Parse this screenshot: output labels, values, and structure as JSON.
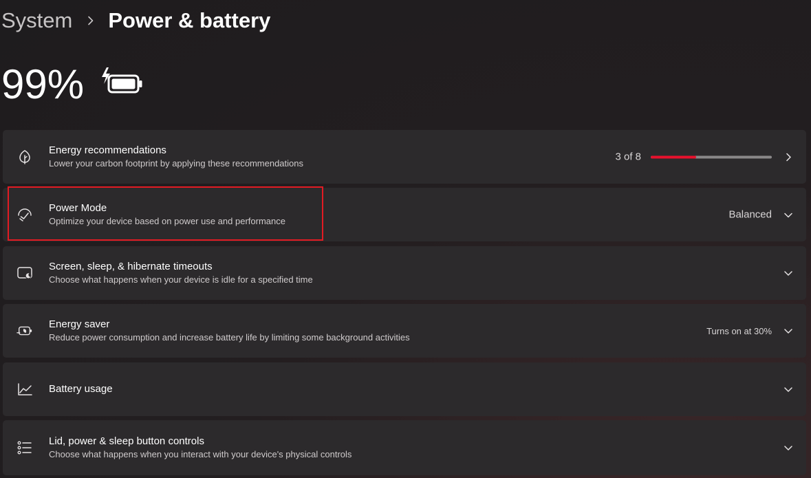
{
  "breadcrumb": {
    "parent": "System",
    "separator": "›",
    "current": "Power & battery"
  },
  "battery": {
    "percent": "99%",
    "icon": "battery-charging-icon"
  },
  "cards": {
    "energy_recommendations": {
      "title": "Energy recommendations",
      "subtitle": "Lower your carbon footprint by applying these recommendations",
      "value": "3 of 8",
      "progress_fraction": 0.375,
      "icon": "leaf-icon"
    },
    "power_mode": {
      "title": "Power Mode",
      "subtitle": "Optimize your device based on power use and performance",
      "value": "Balanced",
      "icon": "power-mode-icon"
    },
    "screen_sleep": {
      "title": "Screen, sleep, & hibernate timeouts",
      "subtitle": "Choose what happens when your device is idle for a specified time",
      "icon": "screen-sleep-icon"
    },
    "energy_saver": {
      "title": "Energy saver",
      "subtitle": "Reduce power consumption and increase battery life by limiting some background activities",
      "value": "Turns on at 30%",
      "icon": "energy-saver-icon"
    },
    "battery_usage": {
      "title": "Battery usage",
      "icon": "chart-line-icon"
    },
    "lid_controls": {
      "title": "Lid, power & sleep button controls",
      "subtitle": "Choose what happens when you interact with your device's physical controls",
      "icon": "list-icon"
    }
  },
  "colors": {
    "accent": "#e8112d",
    "highlight_box": "#e31b23",
    "card_bg": "#2c2a2c"
  }
}
